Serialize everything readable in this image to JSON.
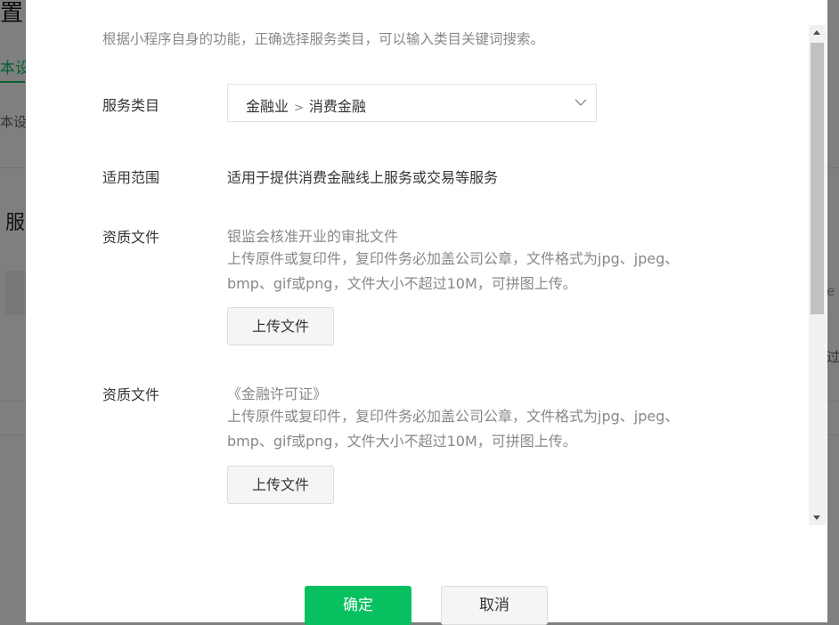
{
  "background": {
    "title": "置",
    "tab": "本设",
    "subtitle": "本设置",
    "heading": "服",
    "right_text": "过",
    "right_mark": "e"
  },
  "dialog": {
    "intro": "根据小程序自身的功能，正确选择服务类目，可以输入类目关键词搜索。",
    "service_category": {
      "label": "服务类目",
      "level1": "金融业",
      "separator": ">",
      "level2": "消费金融"
    },
    "scope": {
      "label": "适用范围",
      "value": "适用于提供消费金融线上服务或交易等服务"
    },
    "qualifications": [
      {
        "label": "资质文件",
        "title": "银监会核准开业的审批文件",
        "desc_line1": "上传原件或复印件，复印件务必加盖公司公章，文件格式为jpg、jpeg、",
        "desc_line2": "bmp、gif或png，文件大小不超过10M，可拼图上传。",
        "button": "上传文件"
      },
      {
        "label": "资质文件",
        "title": "《金融许可证》",
        "desc_line1": "上传原件或复印件，复印件务必加盖公司公章，文件格式为jpg、jpeg、",
        "desc_line2": "bmp、gif或png，文件大小不超过10M，可拼图上传。",
        "button": "上传文件"
      }
    ],
    "confirm_button": "确定",
    "cancel_button": "取消"
  },
  "colors": {
    "primary": "#07c160",
    "overlay": "rgba(0,0,0,0.5)"
  }
}
